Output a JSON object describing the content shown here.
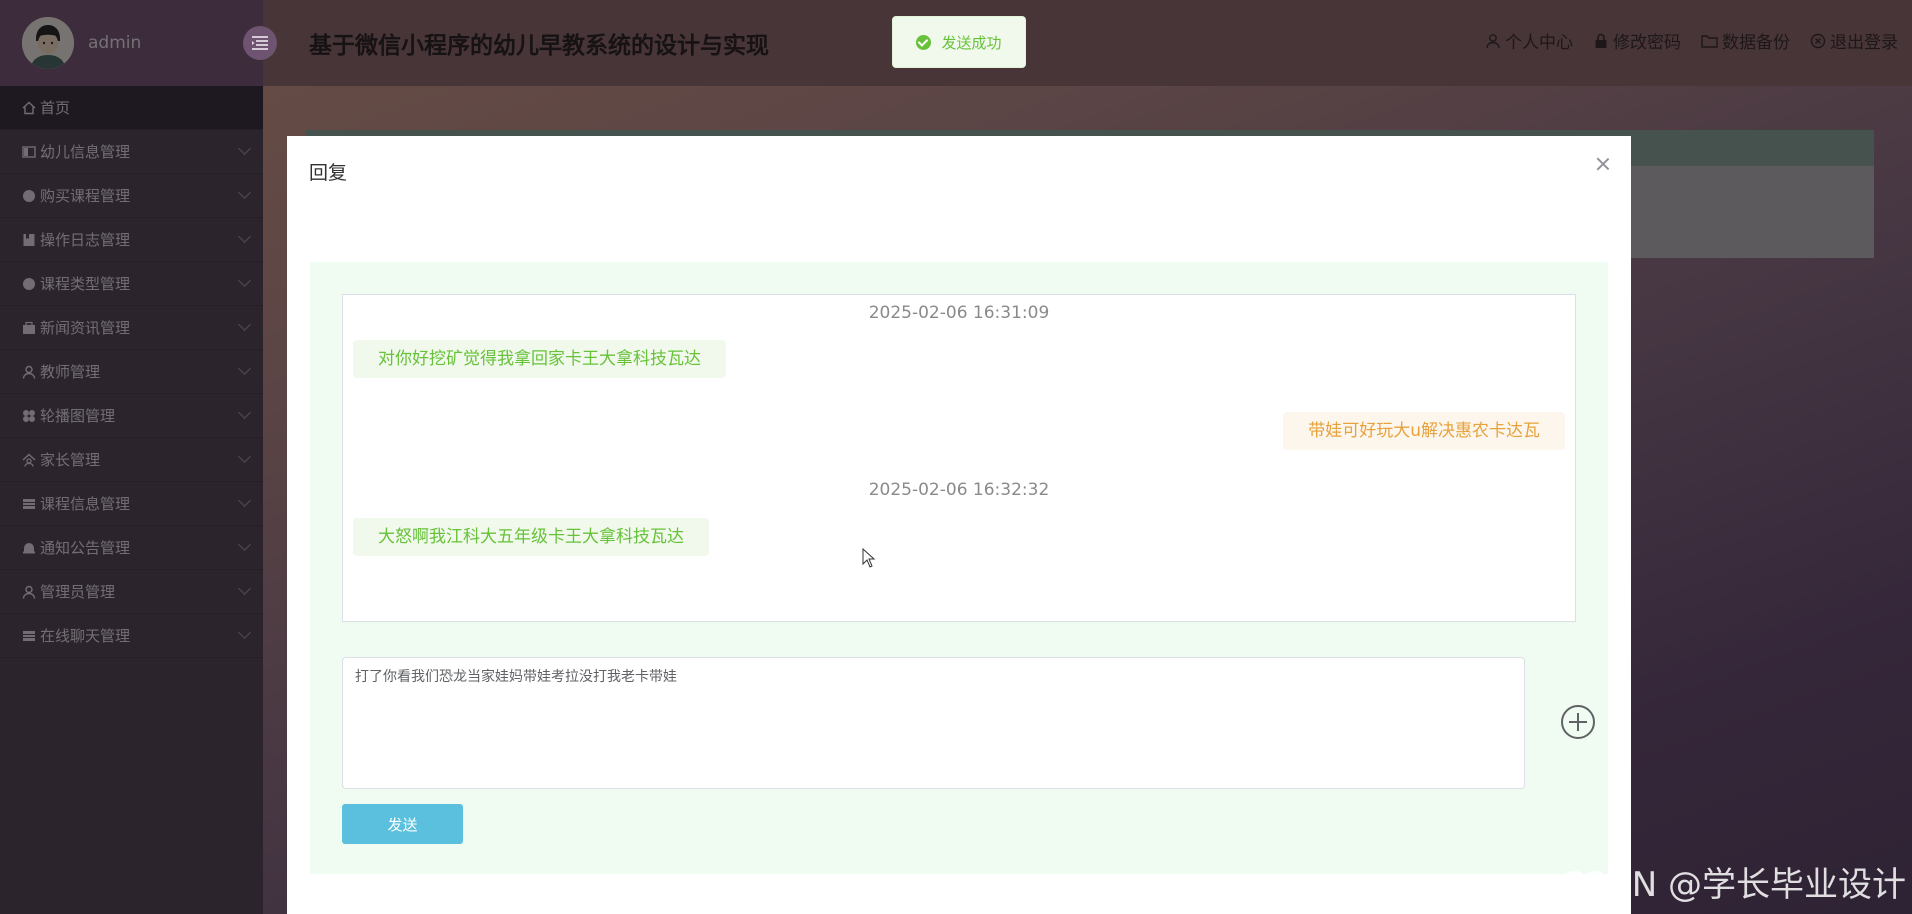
{
  "sidebar": {
    "username": "admin",
    "items": [
      {
        "label": "首页",
        "icon": "home-icon"
      },
      {
        "label": "幼儿信息管理",
        "icon": "card-icon"
      },
      {
        "label": "购买课程管理",
        "icon": "circle-icon"
      },
      {
        "label": "操作日志管理",
        "icon": "log-icon"
      },
      {
        "label": "课程类型管理",
        "icon": "circle-icon"
      },
      {
        "label": "新闻资讯管理",
        "icon": "news-icon"
      },
      {
        "label": "教师管理",
        "icon": "user-icon"
      },
      {
        "label": "轮播图管理",
        "icon": "clover-icon"
      },
      {
        "label": "家长管理",
        "icon": "parent-icon"
      },
      {
        "label": "课程信息管理",
        "icon": "list-icon"
      },
      {
        "label": "通知公告管理",
        "icon": "bell-icon"
      },
      {
        "label": "管理员管理",
        "icon": "user-icon"
      },
      {
        "label": "在线聊天管理",
        "icon": "list-icon"
      }
    ]
  },
  "header": {
    "title": "基于微信小程序的幼儿早教系统的设计与实现",
    "links": [
      {
        "label": "个人中心",
        "icon": "user-icon"
      },
      {
        "label": "修改密码",
        "icon": "lock-icon"
      },
      {
        "label": "数据备份",
        "icon": "folder-icon"
      },
      {
        "label": "退出登录",
        "icon": "logout-icon"
      }
    ]
  },
  "toast": {
    "message": "发送成功"
  },
  "dialog": {
    "title": "回复",
    "messages": [
      {
        "timestamp": "2025-02-06 16:31:09",
        "left": "对你好挖矿觉得我拿回家卡王大拿科技瓦达",
        "right": "带娃可好玩大u解决惠农卡达瓦"
      },
      {
        "timestamp": "2025-02-06 16:32:32",
        "left": "大怒啊我江科大五年级卡王大拿科技瓦达",
        "right": ""
      }
    ],
    "input_value": "打了你看我们恐龙当家娃妈带娃考拉没打我老卡带娃",
    "send_label": "发送"
  },
  "watermark": "CSDN @学长毕业设计",
  "colors": {
    "sidebar": "#57485a",
    "accent_green": "#67c23a",
    "accent_orange": "#e6a23c",
    "send_button": "#5bc0de"
  }
}
